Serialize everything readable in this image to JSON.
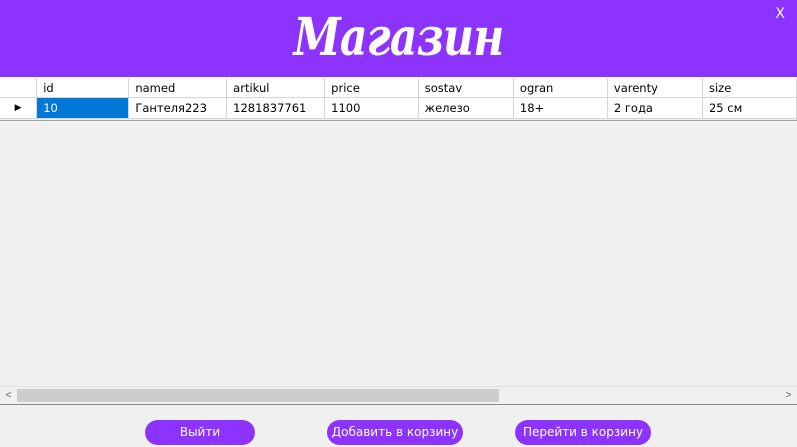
{
  "header": {
    "title": "Магазин",
    "close_label": "X"
  },
  "table": {
    "columns": [
      "id",
      "named",
      "artikul",
      "price",
      "sostav",
      "ogran",
      "varenty",
      "size"
    ],
    "rows": [
      {
        "current_row_marker": "▶",
        "cells": [
          "10",
          "Гантеля223",
          "1281837761",
          "1100",
          "железо",
          "18+",
          "2 года",
          "25 см"
        ]
      }
    ],
    "selected_cell": "id"
  },
  "scrollbar": {
    "left_arrow": "<",
    "right_arrow": ">"
  },
  "buttons": {
    "exit": "Выйти",
    "add_to_cart": "Добавить в корзину",
    "go_to_cart": "Перейти в корзину"
  },
  "colors": {
    "accent": "#8d33ff",
    "selection": "#0078d7"
  }
}
